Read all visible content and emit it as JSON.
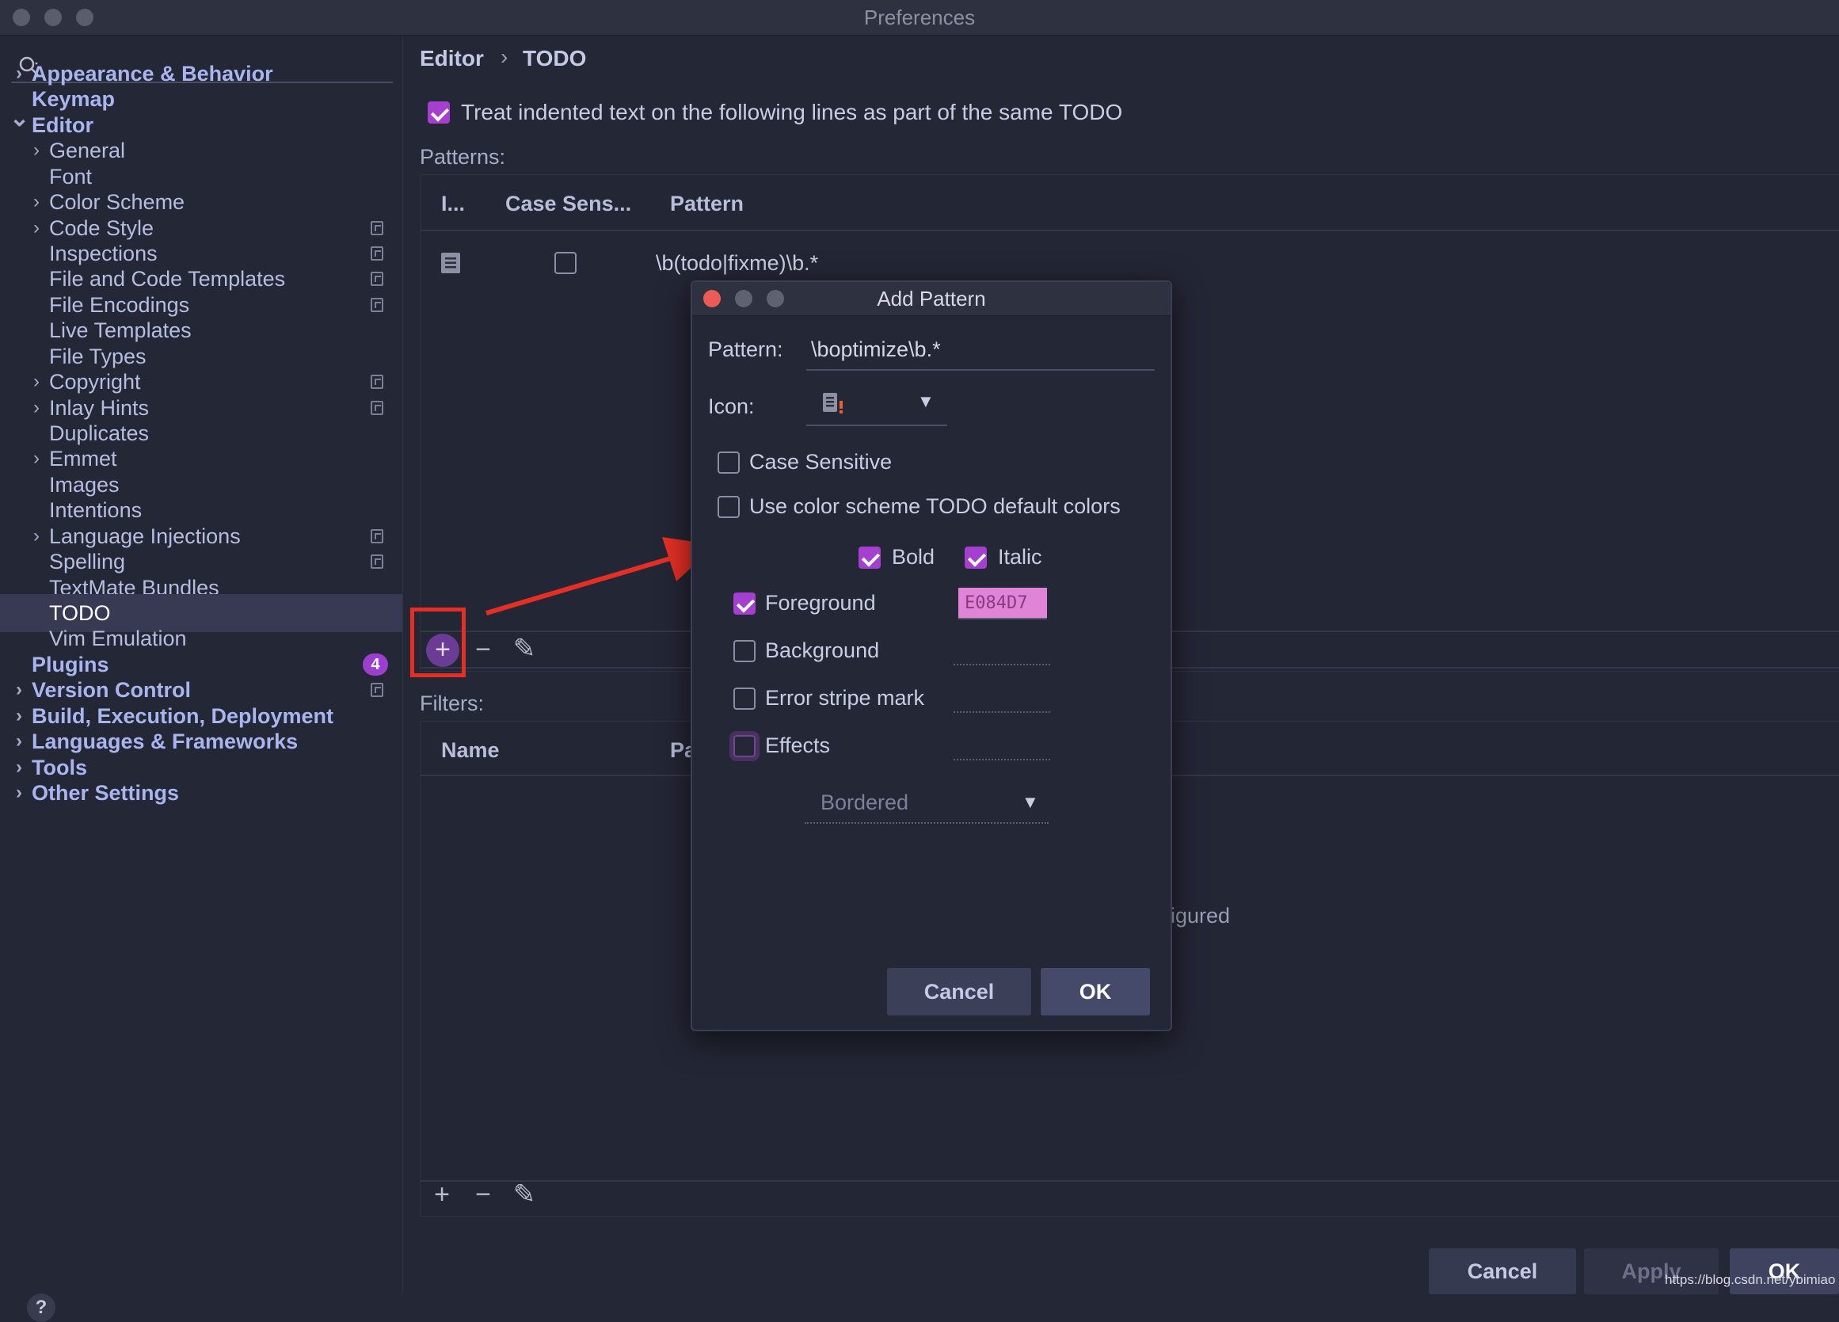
{
  "window": {
    "title": "Preferences"
  },
  "sidebar": {
    "items": [
      {
        "label": "Appearance & Behavior",
        "level": 0,
        "bold": true,
        "expand": "collapsed",
        "project": false
      },
      {
        "label": "Keymap",
        "level": 0,
        "bold": true,
        "expand": "none",
        "project": false
      },
      {
        "label": "Editor",
        "level": 0,
        "bold": true,
        "expand": "expanded",
        "project": false
      },
      {
        "label": "General",
        "level": 1,
        "bold": false,
        "expand": "collapsed",
        "project": false
      },
      {
        "label": "Font",
        "level": 1,
        "bold": false,
        "expand": "none",
        "project": false
      },
      {
        "label": "Color Scheme",
        "level": 1,
        "bold": false,
        "expand": "collapsed",
        "project": false
      },
      {
        "label": "Code Style",
        "level": 1,
        "bold": false,
        "expand": "collapsed",
        "project": true
      },
      {
        "label": "Inspections",
        "level": 1,
        "bold": false,
        "expand": "none",
        "project": true
      },
      {
        "label": "File and Code Templates",
        "level": 1,
        "bold": false,
        "expand": "none",
        "project": true
      },
      {
        "label": "File Encodings",
        "level": 1,
        "bold": false,
        "expand": "none",
        "project": true
      },
      {
        "label": "Live Templates",
        "level": 1,
        "bold": false,
        "expand": "none",
        "project": false
      },
      {
        "label": "File Types",
        "level": 1,
        "bold": false,
        "expand": "none",
        "project": false
      },
      {
        "label": "Copyright",
        "level": 1,
        "bold": false,
        "expand": "collapsed",
        "project": true
      },
      {
        "label": "Inlay Hints",
        "level": 1,
        "bold": false,
        "expand": "collapsed",
        "project": true
      },
      {
        "label": "Duplicates",
        "level": 1,
        "bold": false,
        "expand": "none",
        "project": false
      },
      {
        "label": "Emmet",
        "level": 1,
        "bold": false,
        "expand": "collapsed",
        "project": false
      },
      {
        "label": "Images",
        "level": 1,
        "bold": false,
        "expand": "none",
        "project": false
      },
      {
        "label": "Intentions",
        "level": 1,
        "bold": false,
        "expand": "none",
        "project": false
      },
      {
        "label": "Language Injections",
        "level": 1,
        "bold": false,
        "expand": "collapsed",
        "project": true
      },
      {
        "label": "Spelling",
        "level": 1,
        "bold": false,
        "expand": "none",
        "project": true
      },
      {
        "label": "TextMate Bundles",
        "level": 1,
        "bold": false,
        "expand": "none",
        "project": false
      },
      {
        "label": "TODO",
        "level": 1,
        "bold": false,
        "expand": "none",
        "project": false,
        "selected": true
      },
      {
        "label": "Vim Emulation",
        "level": 1,
        "bold": false,
        "expand": "none",
        "project": false
      },
      {
        "label": "Plugins",
        "level": 0,
        "bold": true,
        "expand": "none",
        "project": false,
        "badge": "4"
      },
      {
        "label": "Version Control",
        "level": 0,
        "bold": true,
        "expand": "collapsed",
        "project": true
      },
      {
        "label": "Build, Execution, Deployment",
        "level": 0,
        "bold": true,
        "expand": "collapsed",
        "project": false
      },
      {
        "label": "Languages & Frameworks",
        "level": 0,
        "bold": true,
        "expand": "collapsed",
        "project": false
      },
      {
        "label": "Tools",
        "level": 0,
        "bold": true,
        "expand": "collapsed",
        "project": false
      },
      {
        "label": "Other Settings",
        "level": 0,
        "bold": true,
        "expand": "collapsed",
        "project": false
      }
    ],
    "help_label": "?"
  },
  "main": {
    "breadcrumb": {
      "parent": "Editor",
      "separator": "›",
      "current": "TODO"
    },
    "treat_indented_label": "Treat indented text on the following lines as part of the same TODO",
    "patterns_label": "Patterns:",
    "patterns_columns": [
      "I...",
      "Case Sens...",
      "Pattern"
    ],
    "patterns_rows": [
      {
        "pattern": "\\b(todo|fixme)\\b.*",
        "case_sensitive": false
      }
    ],
    "filters_label": "Filters:",
    "filters_columns": [
      "Name",
      "Pa"
    ],
    "filters_empty_fragment": "igured",
    "tool_add": "+",
    "tool_remove": "−",
    "tool_edit": "✎"
  },
  "dialog": {
    "title": "Add Pattern",
    "pattern_label": "Pattern:",
    "pattern_value": "\\boptimize\\b.*",
    "icon_label": "Icon:",
    "case_sensitive_label": "Case Sensitive",
    "use_default_colors_label": "Use color scheme TODO default colors",
    "bold_label": "Bold",
    "italic_label": "Italic",
    "foreground_label": "Foreground",
    "foreground_value": "E084D7",
    "background_label": "Background",
    "error_stripe_label": "Error stripe mark",
    "effects_label": "Effects",
    "effects_type": "Bordered",
    "cancel_label": "Cancel",
    "ok_label": "OK"
  },
  "footer": {
    "cancel_label": "Cancel",
    "apply_label": "Apply",
    "ok_label": "OK",
    "watermark": "https://blog.csdn.net/ybimiao"
  },
  "colors": {
    "accent": "#a43fcf",
    "foreground_swatch": "#e084d7",
    "annotation_red": "#e52f24"
  }
}
